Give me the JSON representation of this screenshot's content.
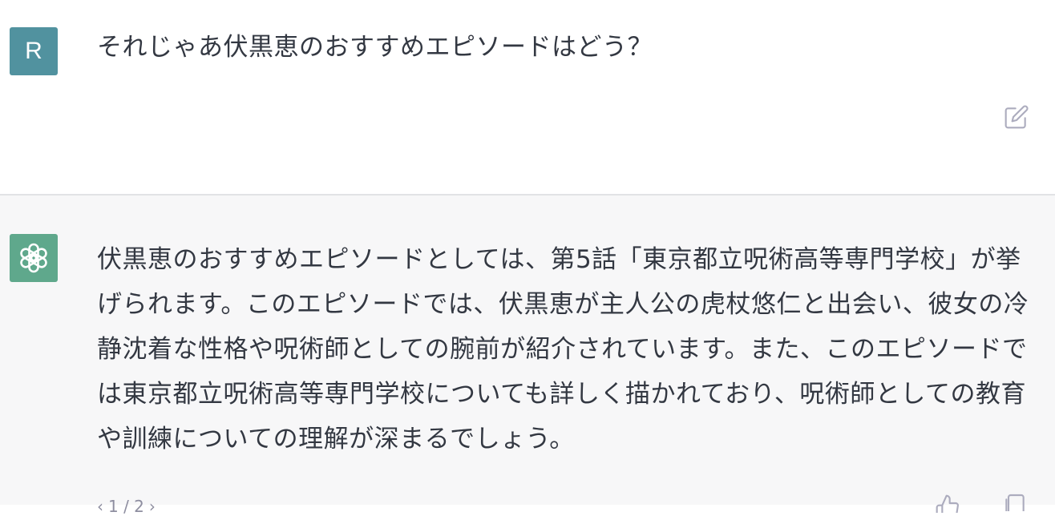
{
  "user_message": {
    "avatar_letter": "R",
    "avatar_color": "#51929f",
    "text": "それじゃあ伏黒恵のおすすめエピソードはどう？",
    "edit_icon": "pencil-square-icon"
  },
  "assistant_message": {
    "avatar_color": "#5fa88c",
    "avatar_icon": "openai-logo-icon",
    "text": "伏黒恵のおすすめエピソードとしては、第5話「東京都立呪術高等専門学校」が挙げられます。このエピソードでは、伏黒恵が主人公の虎杖悠仁と出会い、彼女の冷静沈着な性格や呪術師としての腕前が紹介されています。また、このエピソードでは東京都立呪術高等専門学校についても詳しく描かれており、呪術師としての教育や訓練についての理解が深まるでしょう。",
    "pager": {
      "prev": "‹",
      "label": "1 / 2",
      "next": "›"
    },
    "thumb_icon": "thumbs-up-icon",
    "copy_icon": "clipboard-icon"
  },
  "colors": {
    "user_bg": "#ffffff",
    "assistant_bg": "#f7f7f8",
    "divider": "#e2e3e5",
    "text": "#333842",
    "icon": "#acacbe"
  }
}
